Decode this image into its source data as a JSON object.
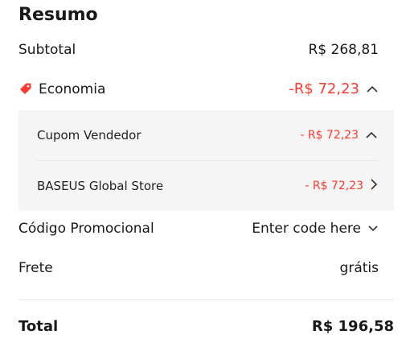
{
  "summary": {
    "title": "Resumo",
    "subtotal_label": "Subtotal",
    "subtotal_value": "R$ 268,81",
    "economia_label": "Economia",
    "economia_value": "-R$ 72,23",
    "economia_icon": "tag-icon",
    "economia_expanded_icon": "chevron-up-icon",
    "details": [
      {
        "label": "Cupom Vendedor",
        "value": "- R$ 72,23",
        "icon": "chevron-up-icon"
      },
      {
        "label": "BASEUS Global Store",
        "value": "- R$ 72,23",
        "icon": "chevron-right-icon"
      }
    ],
    "promo_label": "Código Promocional",
    "promo_value": "Enter code here",
    "promo_icon": "chevron-down-icon",
    "frete_label": "Frete",
    "frete_value": "grátis",
    "total_label": "Total",
    "total_value": "R$ 196,58"
  },
  "colors": {
    "discount_red": "#fd3a2e",
    "panel_bg": "#f5f5f5",
    "text": "#191919"
  }
}
